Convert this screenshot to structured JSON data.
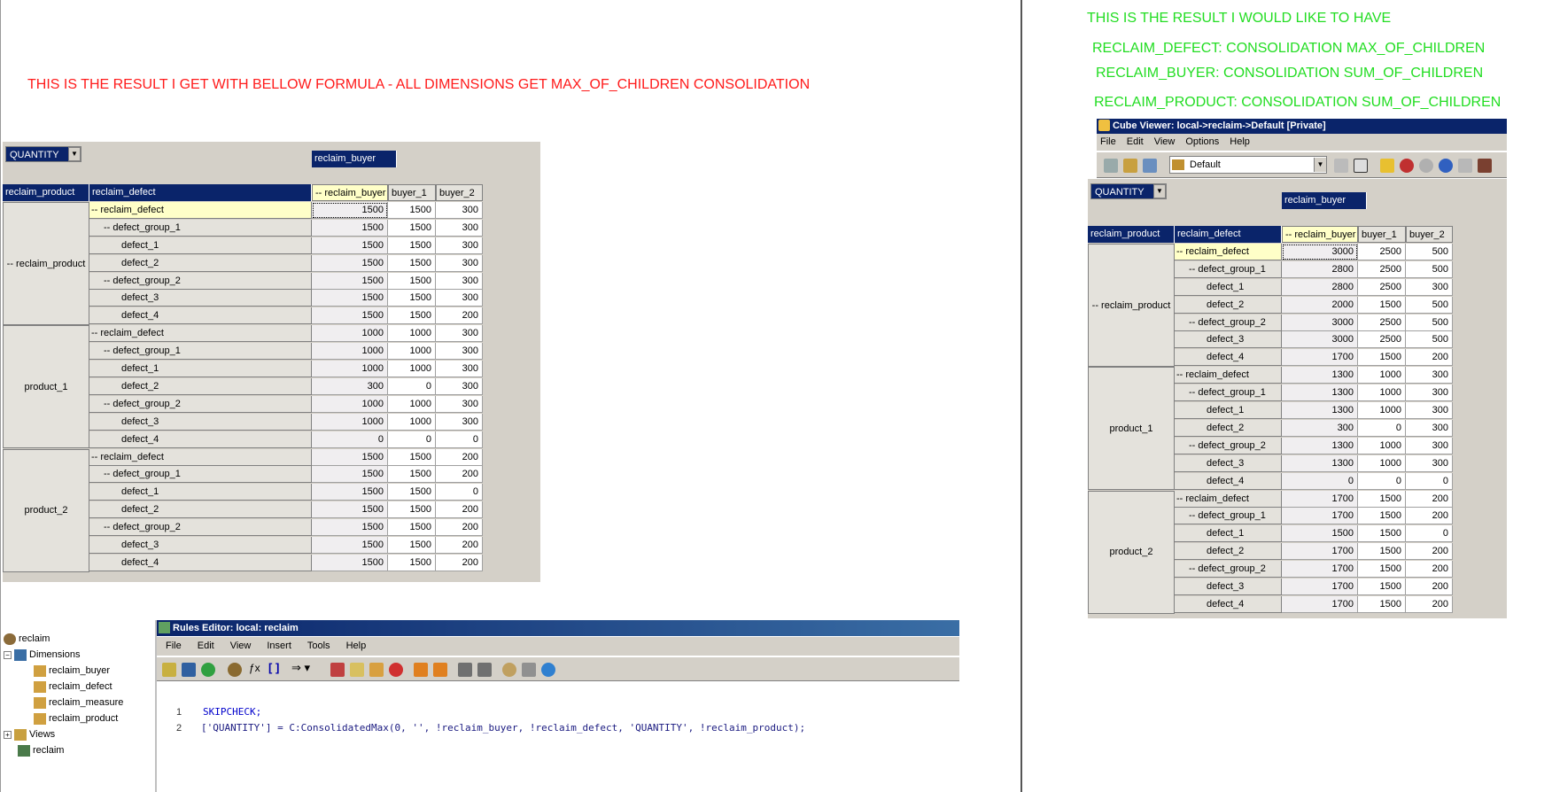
{
  "annotations": {
    "left_result": "THIS IS THE RESULT I GET WITH BELLOW FORMULA - ALL DIMENSIONS GET MAX_OF_CHILDREN CONSOLIDATION",
    "right_wish": "THIS IS THE RESULT I WOULD LIKE TO HAVE",
    "right_defect": "RECLAIM_DEFECT: CONSOLIDATION MAX_OF_CHILDREN",
    "right_buyer": "RECLAIM_BUYER: CONSOLIDATION SUM_OF_CHILDREN",
    "right_product": "RECLAIM_PRODUCT: CONSOLIDATION SUM_OF_CHILDREN"
  },
  "colors": {
    "header_blue": "#0a246a",
    "red": "#ff1a1a",
    "green": "#22dd22",
    "selected": "#ffffc8"
  },
  "left_grid": {
    "measure": "QUANTITY",
    "col_dim": "reclaim_buyer",
    "row_dims": [
      "reclaim_product",
      "reclaim_defect"
    ],
    "cols": [
      "-- reclaim_buyer",
      "buyer_1",
      "buyer_2"
    ],
    "products": [
      "-- reclaim_product",
      "product_1",
      "product_2"
    ],
    "defects": [
      "-- reclaim_defect",
      "-- defect_group_1",
      "defect_1",
      "defect_2",
      "-- defect_group_2",
      "defect_3",
      "defect_4"
    ],
    "values": [
      [
        [
          "1500",
          "1500",
          "300"
        ],
        [
          "1500",
          "1500",
          "300"
        ],
        [
          "1500",
          "1500",
          "300"
        ],
        [
          "1500",
          "1500",
          "300"
        ],
        [
          "1500",
          "1500",
          "300"
        ],
        [
          "1500",
          "1500",
          "300"
        ],
        [
          "1500",
          "1500",
          "200"
        ]
      ],
      [
        [
          "1000",
          "1000",
          "300"
        ],
        [
          "1000",
          "1000",
          "300"
        ],
        [
          "1000",
          "1000",
          "300"
        ],
        [
          "300",
          "0",
          "300"
        ],
        [
          "1000",
          "1000",
          "300"
        ],
        [
          "1000",
          "1000",
          "300"
        ],
        [
          "0",
          "0",
          "0"
        ]
      ],
      [
        [
          "1500",
          "1500",
          "200"
        ],
        [
          "1500",
          "1500",
          "200"
        ],
        [
          "1500",
          "1500",
          "0"
        ],
        [
          "1500",
          "1500",
          "200"
        ],
        [
          "1500",
          "1500",
          "200"
        ],
        [
          "1500",
          "1500",
          "200"
        ],
        [
          "1500",
          "1500",
          "200"
        ]
      ]
    ]
  },
  "right_grid": {
    "window_title": "Cube Viewer: local->reclaim->Default  [Private]",
    "menu": [
      "File",
      "Edit",
      "View",
      "Options",
      "Help"
    ],
    "view_name": "Default",
    "measure": "QUANTITY",
    "col_dim": "reclaim_buyer",
    "row_dims": [
      "reclaim_product",
      "reclaim_defect"
    ],
    "cols": [
      "-- reclaim_buyer",
      "buyer_1",
      "buyer_2"
    ],
    "products": [
      "-- reclaim_product",
      "product_1",
      "product_2"
    ],
    "defects": [
      "-- reclaim_defect",
      "-- defect_group_1",
      "defect_1",
      "defect_2",
      "-- defect_group_2",
      "defect_3",
      "defect_4"
    ],
    "values": [
      [
        [
          "3000",
          "2500",
          "500"
        ],
        [
          "2800",
          "2500",
          "500"
        ],
        [
          "2800",
          "2500",
          "300"
        ],
        [
          "2000",
          "1500",
          "500"
        ],
        [
          "3000",
          "2500",
          "500"
        ],
        [
          "3000",
          "2500",
          "500"
        ],
        [
          "1700",
          "1500",
          "200"
        ]
      ],
      [
        [
          "1300",
          "1000",
          "300"
        ],
        [
          "1300",
          "1000",
          "300"
        ],
        [
          "1300",
          "1000",
          "300"
        ],
        [
          "300",
          "0",
          "300"
        ],
        [
          "1300",
          "1000",
          "300"
        ],
        [
          "1300",
          "1000",
          "300"
        ],
        [
          "0",
          "0",
          "0"
        ]
      ],
      [
        [
          "1700",
          "1500",
          "200"
        ],
        [
          "1700",
          "1500",
          "200"
        ],
        [
          "1500",
          "1500",
          "0"
        ],
        [
          "1700",
          "1500",
          "200"
        ],
        [
          "1700",
          "1500",
          "200"
        ],
        [
          "1700",
          "1500",
          "200"
        ],
        [
          "1700",
          "1500",
          "200"
        ]
      ]
    ]
  },
  "tree": {
    "root": "reclaim",
    "dimensions_label": "Dimensions",
    "dimensions": [
      "reclaim_buyer",
      "reclaim_defect",
      "reclaim_measure",
      "reclaim_product"
    ],
    "views_label": "Views",
    "rules_item": "reclaim"
  },
  "rules_editor": {
    "title": "Rules Editor: local: reclaim",
    "menu": [
      "File",
      "Edit",
      "View",
      "Insert",
      "Tools",
      "Help"
    ],
    "lines": [
      {
        "num": "1",
        "text": "SKIPCHECK;"
      },
      {
        "num": "2",
        "text": "['QUANTITY'] = C:ConsolidatedMax(0, '', !reclaim_buyer, !reclaim_defect, 'QUANTITY', !reclaim_product);"
      }
    ]
  }
}
